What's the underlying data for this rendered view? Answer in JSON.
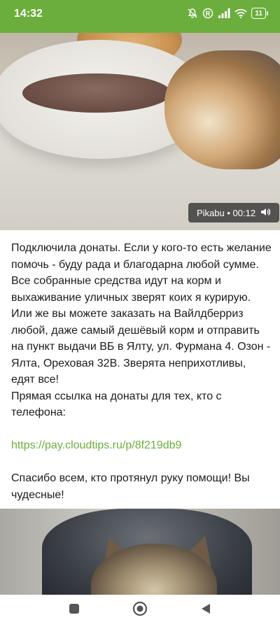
{
  "status_bar": {
    "time": "14:32",
    "battery": "11",
    "icons": [
      "mute-bell-icon",
      "registered-icon",
      "signal-icon",
      "wifi-icon",
      "battery-icon"
    ],
    "background": "#6cae3d"
  },
  "video": {
    "source_label": "Pikabu • 00:12",
    "volume_icon": "volume-icon"
  },
  "article": {
    "paragraph": "Подключила донаты. Если у кого-то есть желание помочь - буду рада и благодарна любой сумме. Все собранные средства идут на корм и выхаживание уличных зверят коих я курирую. Или же вы можете заказать на Вайлдберриз любой, даже самый дешёвый корм и отправить на пункт выдачи ВБ в Ялту, ул. Фурмана 4. Озон - Ялта, Ореховая 32В. Зверята неприхотливы, едят все!",
    "direct_link_line": "Прямая ссылка на донаты для тех, кто с телефона:",
    "link": "https://pay.cloudtips.ru/p/8f219db9",
    "thanks": "Спасибо всем, кто протянул руку помощи! Вы чудесные!",
    "link_color": "#6cae3d"
  },
  "nav_bar": {
    "buttons": [
      "recents-square-icon",
      "home-circle-icon",
      "back-triangle-icon"
    ]
  }
}
